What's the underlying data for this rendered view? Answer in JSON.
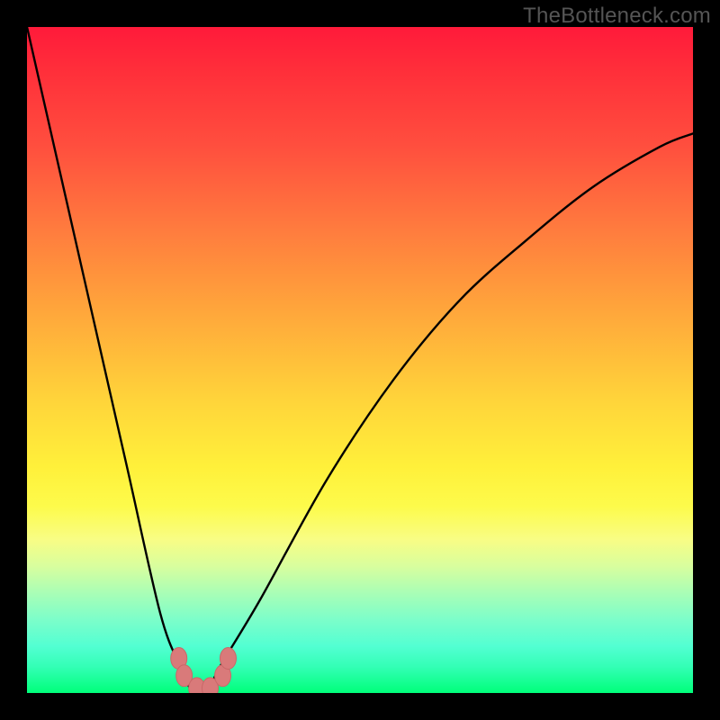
{
  "watermark": "TheBottleneck.com",
  "chart_data": {
    "type": "line",
    "title": "",
    "xlabel": "",
    "ylabel": "",
    "xlim": [
      0,
      100
    ],
    "ylim": [
      0,
      100
    ],
    "grid": false,
    "legend": false,
    "series": [
      {
        "name": "bottleneck-curve",
        "x": [
          0,
          5,
          10,
          15,
          20,
          23,
          25,
          27,
          29,
          35,
          45,
          55,
          65,
          75,
          85,
          95,
          100
        ],
        "values": [
          100,
          78,
          56,
          34,
          12,
          4,
          0,
          0,
          4,
          14,
          32,
          47,
          59,
          68,
          76,
          82,
          84
        ]
      }
    ],
    "markers": [
      {
        "name": "marker-left-upper",
        "x": 22.8,
        "y": 5.2
      },
      {
        "name": "marker-left-lower",
        "x": 23.6,
        "y": 2.6
      },
      {
        "name": "marker-bottom-left",
        "x": 25.5,
        "y": 0.7
      },
      {
        "name": "marker-bottom-right",
        "x": 27.5,
        "y": 0.7
      },
      {
        "name": "marker-right-lower",
        "x": 29.4,
        "y": 2.6
      },
      {
        "name": "marker-right-upper",
        "x": 30.2,
        "y": 5.2
      }
    ],
    "colors": {
      "curve": "#000000",
      "marker_fill": "#d97a7a",
      "marker_stroke": "#c96868",
      "background_top": "#ff1a3a",
      "background_bottom": "#00ff7a"
    }
  }
}
